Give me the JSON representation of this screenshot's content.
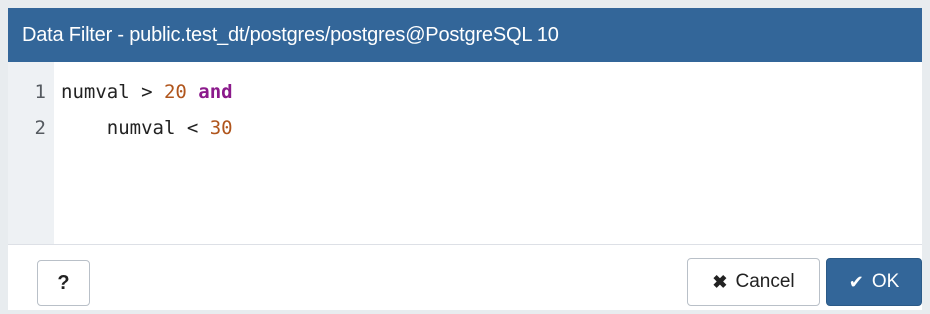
{
  "dialog": {
    "title": "Data Filter - public.test_dt/postgres/postgres@PostgreSQL 10"
  },
  "editor": {
    "lines": [
      {
        "number": "1",
        "tokens": [
          {
            "text": "numval > ",
            "type": "plain"
          },
          {
            "text": "20",
            "type": "number"
          },
          {
            "text": " ",
            "type": "plain"
          },
          {
            "text": "and",
            "type": "keyword"
          }
        ]
      },
      {
        "number": "2",
        "tokens": [
          {
            "text": "    numval < ",
            "type": "plain"
          },
          {
            "text": "30",
            "type": "number"
          }
        ]
      }
    ],
    "colors": {
      "number": "#b0551c",
      "keyword": "#8b1a8b",
      "gutter": "#eef1f4"
    }
  },
  "footer": {
    "help_label": "?",
    "cancel_label": "Cancel",
    "ok_label": "OK",
    "cancel_icon": "times-icon",
    "ok_icon": "check-icon"
  },
  "colors": {
    "titlebar": "#336699",
    "primary_button": "#336699"
  }
}
